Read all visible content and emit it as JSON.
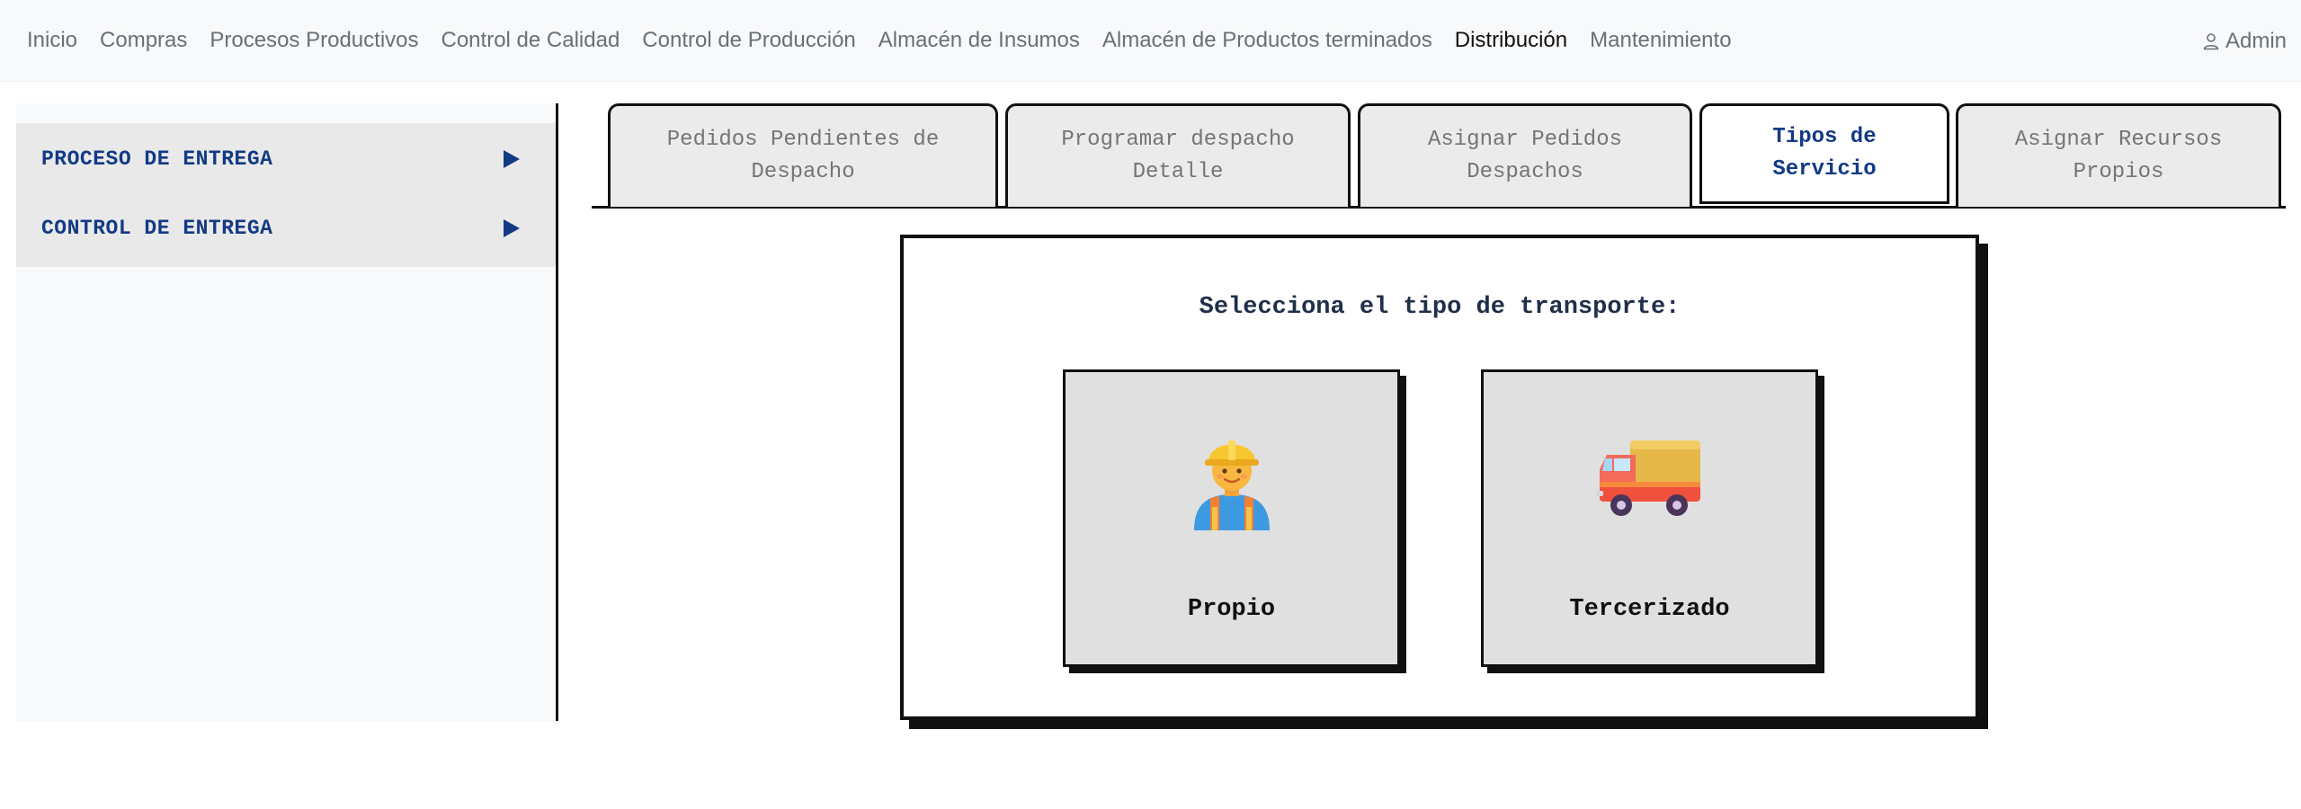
{
  "navbar": {
    "items": [
      {
        "label": "Inicio"
      },
      {
        "label": "Compras"
      },
      {
        "label": "Procesos Productivos"
      },
      {
        "label": "Control de Calidad"
      },
      {
        "label": "Control de Producción"
      },
      {
        "label": "Almacén de Insumos"
      },
      {
        "label": "Almacén de Productos terminados"
      },
      {
        "label": "Distribución",
        "active": true
      },
      {
        "label": "Mantenimiento"
      }
    ],
    "user_label": "Admin",
    "user_icon": "user-icon"
  },
  "sidebar": {
    "items": [
      {
        "label": "PROCESO DE ENTREGA",
        "icon": "arrow-right-icon"
      },
      {
        "label": "CONTROL DE ENTREGA",
        "icon": "arrow-right-icon"
      }
    ]
  },
  "tabs": [
    {
      "label": "Pedidos Pendientes de Despacho"
    },
    {
      "label": "Programar despacho Detalle"
    },
    {
      "label": "Asignar Pedidos Despachos"
    },
    {
      "label": "Tipos de Servicio",
      "active": true
    },
    {
      "label": "Asignar Recursos Propios"
    }
  ],
  "transport_selector": {
    "title": "Selecciona el tipo de transporte:",
    "options": [
      {
        "label": "Propio",
        "icon": "construction-worker-icon"
      },
      {
        "label": "Tercerizado",
        "icon": "delivery-truck-icon"
      }
    ]
  },
  "colors": {
    "accent": "#123a85",
    "navbar_bg": "#f8f9fa",
    "card_bg": "#e0e0e0",
    "tab_bg": "#ebebeb"
  }
}
